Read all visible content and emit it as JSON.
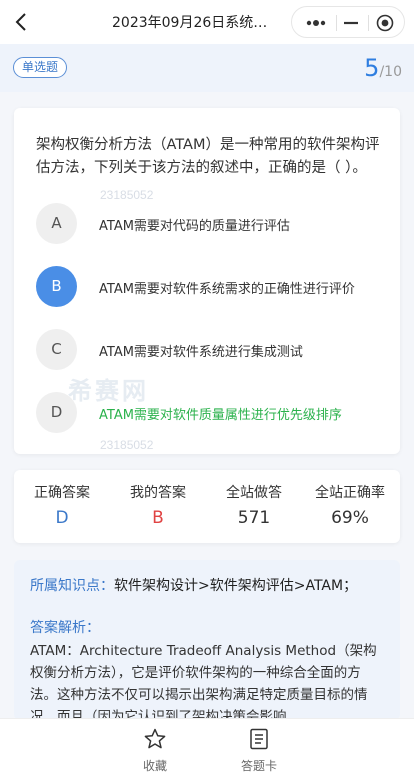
{
  "header": {
    "title": "2023年09月26日系统…",
    "back_icon": "chevron-left-icon",
    "capsule": {
      "more_icon": "more-dots-icon",
      "minimize_icon": "minimize-icon",
      "close_icon": "target-close-icon"
    }
  },
  "question": {
    "type": "单选题",
    "current": "5",
    "separator": "/",
    "total": "10",
    "stem": "架构权衡分析方法（ATAM）是一种常用的软件架构评估方法，下列关于该方法的叙述中，正确的是（ ）。",
    "watermark_ids": [
      "23185052",
      "23185052"
    ],
    "watermark_logo": "希赛网",
    "options": [
      {
        "letter": "A",
        "text": "ATAM需要对代码的质量进行评估",
        "selected": false,
        "correct": false
      },
      {
        "letter": "B",
        "text": "ATAM需要对软件系统需求的正确性进行评价",
        "selected": true,
        "correct": false
      },
      {
        "letter": "C",
        "text": "ATAM需要对软件系统进行集成测试",
        "selected": false,
        "correct": false
      },
      {
        "letter": "D",
        "text": "ATAM需要对软件质量属性进行优先级排序",
        "selected": false,
        "correct": true
      }
    ]
  },
  "stats": {
    "correct_answer": {
      "label": "正确答案",
      "value": "D",
      "color": "#3b78c9"
    },
    "my_answer": {
      "label": "我的答案",
      "value": "B",
      "color": "#e04343"
    },
    "site_attempts": {
      "label": "全站做答",
      "value": "571"
    },
    "site_accuracy": {
      "label": "全站正确率",
      "value": "69%"
    }
  },
  "analysis": {
    "knowledge_label": "所属知识点：",
    "knowledge_value": "软件架构设计>软件架构评估>ATAM；",
    "answer_label": "答案解析：",
    "answer_text": "ATAM：Architecture Tradeoff Analysis Method（架构权衡分析方法），它是评价软件架构的一种综合全面的方法。这种方法不仅可以揭示出架构满足特定质量目标的情况，而且（因为它认识到了架构决策会影响"
  },
  "bottom_tabs": [
    {
      "label": "收藏",
      "icon": "star-icon"
    },
    {
      "label": "答题卡",
      "icon": "answer-sheet-icon"
    }
  ],
  "colors": {
    "accent": "#2f7ee0",
    "correct": "#2bb24c",
    "wrong": "#e04343",
    "selected": "#4a8ee6"
  }
}
